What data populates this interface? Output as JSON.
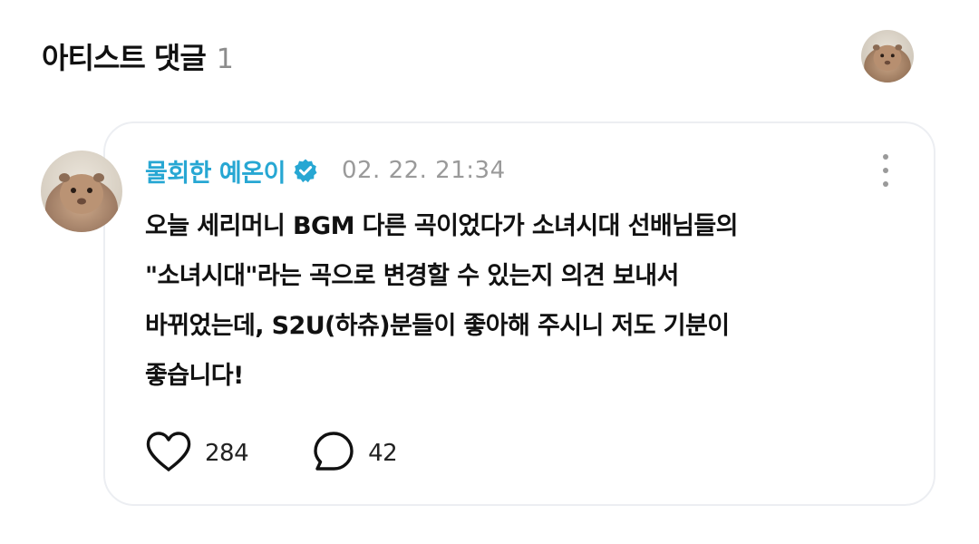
{
  "header": {
    "title": "아티스트 댓글",
    "count": "1"
  },
  "comment": {
    "author": "물회한 예온이",
    "verified": true,
    "timestamp": "02. 22. 21:34",
    "body": "오늘 세리머니 BGM 다른 곡이었다가 소녀시대 선배님들의\n\"소녀시대\"라는 곡으로 변경할 수 있는지 의견 보내서\n바뀌었는데, S2U(하츄)분들이 좋아해 주시니 저도 기분이\n좋습니다!",
    "likes": "284",
    "replies": "42"
  },
  "icons": {
    "like": "heart-outline-icon",
    "reply": "speech-bubble-icon",
    "more": "more-vertical-icon",
    "verified": "verified-badge-icon"
  },
  "colors": {
    "author_name": "#27a7d3",
    "verified_badge": "#27a7d3",
    "muted_text": "#9a9a9a",
    "card_border": "#eceef2"
  }
}
